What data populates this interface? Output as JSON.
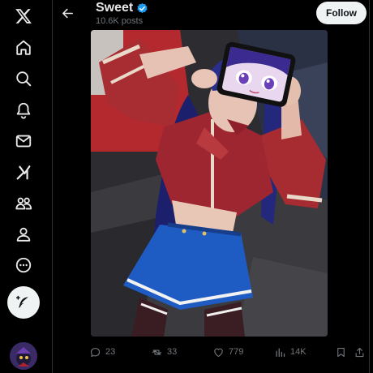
{
  "nav": {
    "items": [
      {
        "icon": "x-logo-icon"
      },
      {
        "icon": "home-icon"
      },
      {
        "icon": "search-icon"
      },
      {
        "icon": "notifications-bell-icon"
      },
      {
        "icon": "messages-envelope-icon"
      },
      {
        "icon": "grok-icon"
      },
      {
        "icon": "communities-icon"
      },
      {
        "icon": "profile-icon"
      },
      {
        "icon": "more-circle-icon"
      }
    ],
    "compose_icon": "compose-feather-icon"
  },
  "header": {
    "title": "Sweet",
    "subtitle": "10.6K posts",
    "follow_label": "Follow"
  },
  "actions": {
    "replies": "23",
    "reposts": "33",
    "likes": "779",
    "views": "14K"
  },
  "colors": {
    "background": "#000000",
    "text_primary": "#e7e9ea",
    "text_secondary": "#71767b",
    "verified": "#1d9bf0",
    "follow_bg": "#eff3f4"
  }
}
